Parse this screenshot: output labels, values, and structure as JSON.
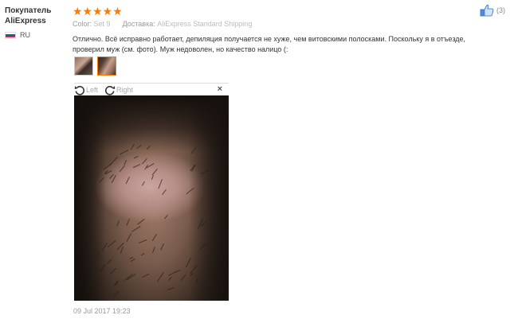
{
  "buyer": {
    "name_line1": "Покупатель",
    "name_line2": "AliExpress",
    "country_code": "RU"
  },
  "review": {
    "rating": 5,
    "stars": "★★★★★",
    "color_label": "Color:",
    "color_value": "Set 9",
    "shipping_label": "Доставка:",
    "shipping_value": "AliExpress Standard Shipping",
    "text_line1": "Отлично. Всё исправно работает, депиляция получается не хуже, чем витовскими полосками. Поскольку я в отъезде,",
    "text_line2": "проверил муж (см. фото). Муж недоволен, но качество налицо (:",
    "date": "09 Jul 2017 19:23"
  },
  "like": {
    "count": "(3)",
    "icon": "thumbs-up-icon"
  },
  "viewer": {
    "rotate_left_label": "Left",
    "rotate_right_label": "Right",
    "close_label": "×"
  },
  "colors": {
    "star": "#ff7a00",
    "accent": "#ff7a00",
    "like_icon": "#4a90e2"
  }
}
